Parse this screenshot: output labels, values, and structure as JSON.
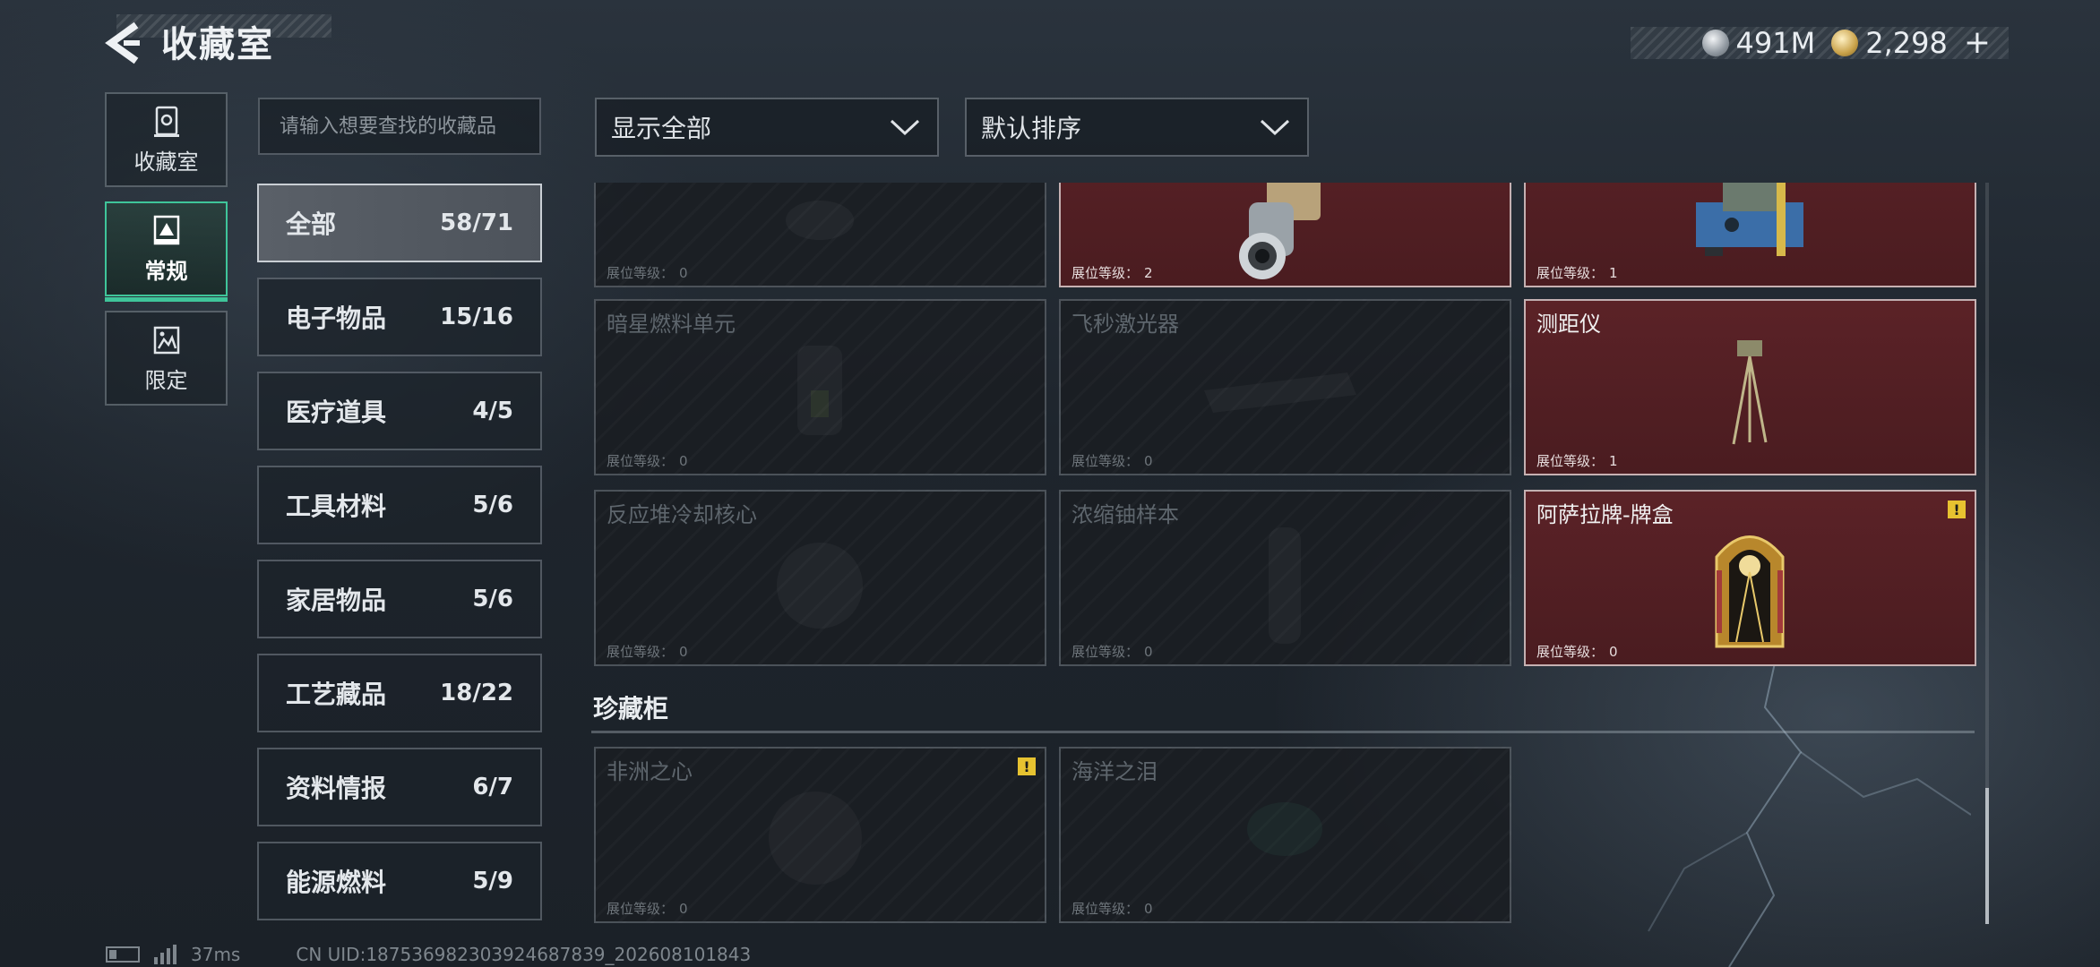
{
  "header": {
    "title": "收藏室",
    "currencies": [
      {
        "icon": "silver-coin-icon",
        "value": "491M"
      },
      {
        "icon": "gold-coin-icon",
        "value": "2,298"
      }
    ],
    "add_label": "+"
  },
  "side_tabs": [
    {
      "label": "收藏室",
      "icon": "vault-icon",
      "active": false
    },
    {
      "label": "常规",
      "icon": "regular-icon",
      "active": true
    },
    {
      "label": "限定",
      "icon": "limited-icon",
      "active": false
    }
  ],
  "search": {
    "placeholder": "请输入想要查找的收藏品"
  },
  "categories": [
    {
      "name": "全部",
      "count": "58/71",
      "active": true
    },
    {
      "name": "电子物品",
      "count": "15/16"
    },
    {
      "name": "医疗道具",
      "count": "4/5"
    },
    {
      "name": "工具材料",
      "count": "5/6"
    },
    {
      "name": "家居物品",
      "count": "5/6"
    },
    {
      "name": "工艺藏品",
      "count": "18/22"
    },
    {
      "name": "资料情报",
      "count": "6/7"
    },
    {
      "name": "能源燃料",
      "count": "5/9"
    }
  ],
  "filters": {
    "display": "显示全部",
    "sort": "默认排序"
  },
  "level_label": "展位等级：",
  "cards": [
    {
      "name": "",
      "level": "0",
      "owned": false
    },
    {
      "name": "",
      "level": "2",
      "owned": true
    },
    {
      "name": "",
      "level": "1",
      "owned": true
    },
    {
      "name": "暗星燃料单元",
      "level": "0",
      "owned": false
    },
    {
      "name": "飞秒激光器",
      "level": "0",
      "owned": false
    },
    {
      "name": "测距仪",
      "level": "1",
      "owned": true
    },
    {
      "name": "反应堆冷却核心",
      "level": "0",
      "owned": false
    },
    {
      "name": "浓缩铀样本",
      "level": "0",
      "owned": false
    },
    {
      "name": "阿萨拉牌-牌盒",
      "level": "0",
      "owned": true,
      "warning": "!"
    }
  ],
  "section": {
    "title": "珍藏柜",
    "cards": [
      {
        "name": "非洲之心",
        "level": "0",
        "owned": false,
        "warning": "!"
      },
      {
        "name": "海洋之泪",
        "level": "0",
        "owned": false
      }
    ]
  },
  "footer": {
    "ping": "37ms",
    "uid": "CN UID:187536982303924687839_202608101843"
  },
  "colors": {
    "accent_green": "#3fc59a",
    "owned_card": "#5b2227",
    "warning": "#e6c230"
  }
}
